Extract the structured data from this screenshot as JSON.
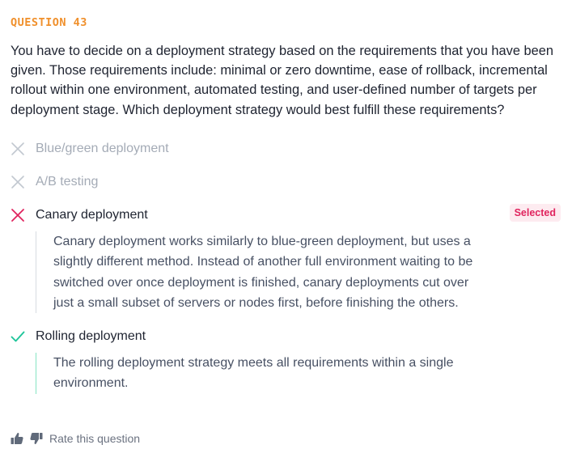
{
  "question": {
    "number_label": "QUESTION 43",
    "text": "You have to decide on a deployment strategy based on the requirements that you have been given. Those requirements include: minimal or zero downtime, ease of rollback, incremental rollout within one environment, automated testing, and user-defined number of targets per deployment stage. Which deployment strategy would best fulfill these requirements?"
  },
  "options": [
    {
      "label": "Blue/green deployment",
      "state": "not-selected",
      "icon": "x-icon"
    },
    {
      "label": "A/B testing",
      "state": "not-selected",
      "icon": "x-icon"
    },
    {
      "label": "Canary deployment",
      "state": "selected-incorrect",
      "icon": "x-icon",
      "badge": "Selected",
      "explanation": "Canary deployment works similarly to blue-green deployment, but uses a slightly different method. Instead of another full environment waiting to be switched over once deployment is finished, canary deployments cut over just a small subset of servers or nodes first, before finishing the others."
    },
    {
      "label": "Rolling deployment",
      "state": "correct",
      "icon": "check-icon",
      "explanation": "The rolling deployment strategy meets all requirements within a single environment."
    }
  ],
  "rating": {
    "label": "Rate this question"
  },
  "colors": {
    "accent_orange": "#f0902c",
    "incorrect_pink": "#e0245e",
    "correct_green": "#1fc59a",
    "muted_gray": "#a4abb6"
  }
}
